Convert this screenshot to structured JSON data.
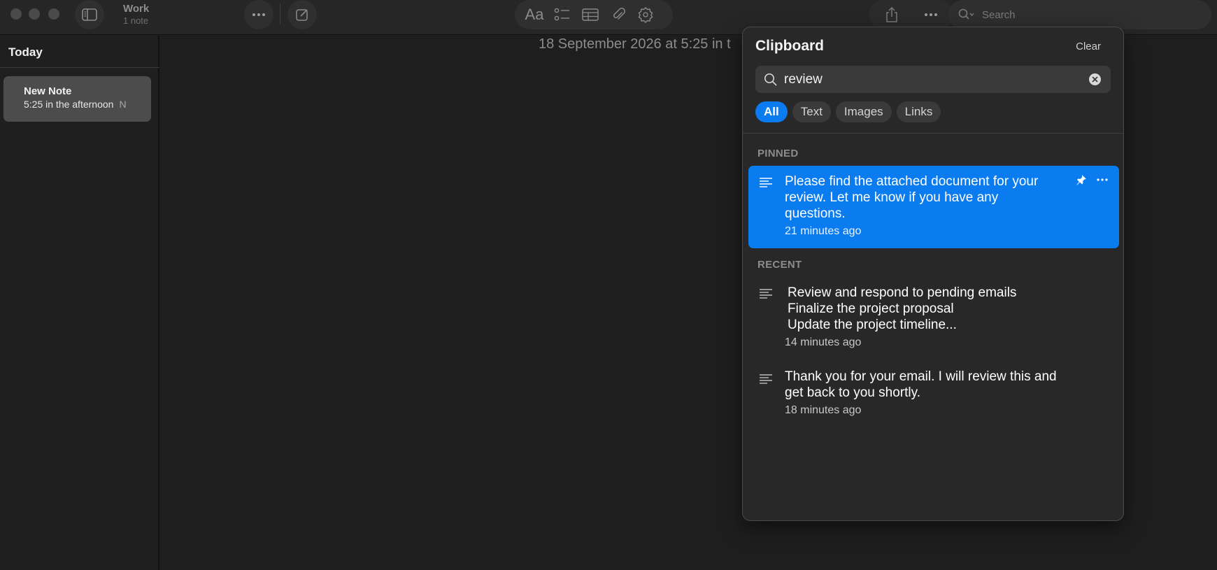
{
  "window": {
    "folder_name": "Work",
    "note_count": "1 note"
  },
  "toolbar": {
    "format_label": "Aa",
    "search_placeholder": "Search"
  },
  "sidebar": {
    "section": "Today",
    "notes": [
      {
        "title": "New Note",
        "time": "5:25 in the afternoon",
        "preview": "N"
      }
    ]
  },
  "editor": {
    "date_text": "18 September 2026 at 5:25 in t"
  },
  "clipboard": {
    "title": "Clipboard",
    "clear_label": "Clear",
    "search_value": "review",
    "filters": [
      "All",
      "Text",
      "Images",
      "Links"
    ],
    "active_filter": "All",
    "pinned_label": "PINNED",
    "recent_label": "RECENT",
    "pinned": [
      {
        "lines": [
          "Please find the attached document for your",
          "review. Let me know if you have any",
          "questions."
        ],
        "time": "21 minutes ago"
      }
    ],
    "recent": [
      {
        "lines": [
          "Review and respond to pending emails",
          "Finalize the project proposal",
          "Update the project timeline..."
        ],
        "time": "14 minutes ago"
      },
      {
        "lines": [
          "Thank you for your email. I will review this and",
          "get back to you shortly."
        ],
        "time": "18 minutes ago"
      }
    ]
  },
  "colors": {
    "accent": "#0a7cf0",
    "background": "#1e1e1e",
    "popover": "#282828"
  }
}
